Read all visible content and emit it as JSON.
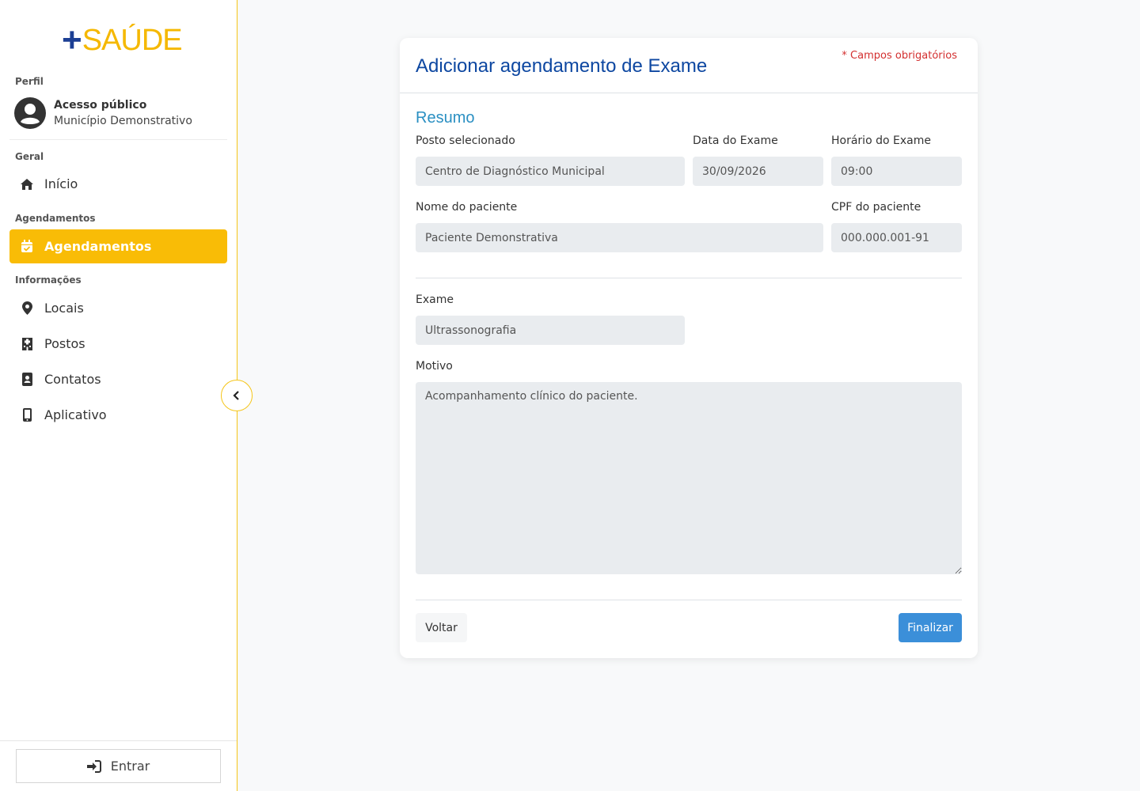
{
  "sidebar": {
    "logo": {
      "plus": "+",
      "name": "SAÚDE"
    },
    "profile_label": "Perfil",
    "profile_name": "Acesso público",
    "profile_sub": "Município Demonstrativo",
    "sections": {
      "geral": "Geral",
      "agendamentos": "Agendamentos",
      "informacoes": "Informações"
    },
    "items": [
      {
        "label": "Início",
        "icon": "home-icon"
      },
      {
        "label": "Agendamentos",
        "icon": "calendar-check-icon",
        "active": true
      },
      {
        "label": "Locais",
        "icon": "map-pin-icon"
      },
      {
        "label": "Postos",
        "icon": "hospital-icon"
      },
      {
        "label": "Contatos",
        "icon": "contact-book-icon"
      },
      {
        "label": "Aplicativo",
        "icon": "mobile-phone-icon"
      }
    ],
    "login_label": "Entrar"
  },
  "form": {
    "title": "Adicionar agendamento de Exame",
    "required_note": "* Campos obrigatórios",
    "section": "Resumo",
    "posto": {
      "label": "Posto selecionado",
      "value": "Centro de Diagnóstico Municipal"
    },
    "data": {
      "label": "Data do Exame",
      "value": "30/09/2026"
    },
    "horario": {
      "label": "Horário do Exame",
      "value": "09:00"
    },
    "nome": {
      "label": "Nome do paciente",
      "value": "Paciente Demonstrativa"
    },
    "cpf": {
      "label": "CPF do paciente",
      "value": "000.000.001-91"
    },
    "exame": {
      "label": "Exame",
      "value": "Ultrassonografia"
    },
    "motivo": {
      "label": "Motivo",
      "value": "Acompanhamento clínico do paciente."
    },
    "back_label": "Voltar",
    "finish_label": "Finalizar"
  },
  "colors": {
    "brand_blue": "#1c3f94",
    "brand_yellow": "#f9bc06",
    "primary_button": "#3b8fd9",
    "required_red": "#d32f2f"
  }
}
